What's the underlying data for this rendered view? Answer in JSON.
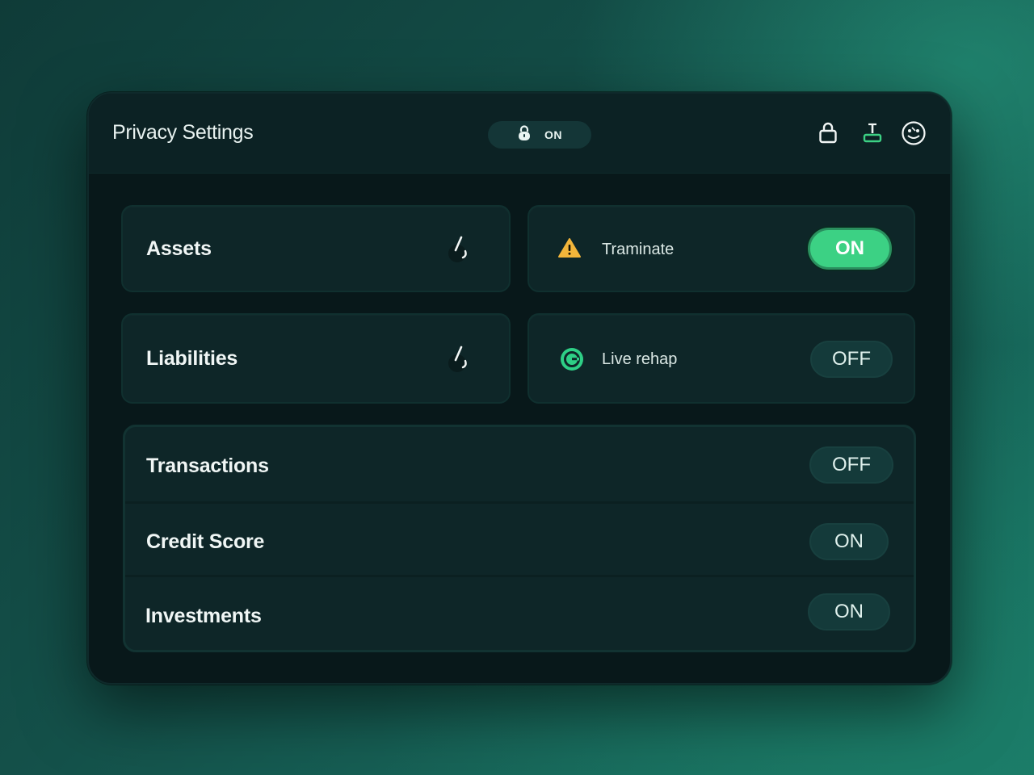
{
  "header": {
    "title": "Privacy Settings",
    "status": {
      "icon": "lock-icon",
      "label": "ON"
    },
    "actions": [
      {
        "name": "lock-icon"
      },
      {
        "name": "stamp-icon",
        "color": "#3cd184"
      },
      {
        "name": "face-icon"
      }
    ]
  },
  "cards": {
    "assets": {
      "label": "Assets",
      "action_icon": "edit-icon"
    },
    "liabilities": {
      "label": "Liabilities",
      "action_icon": "edit-icon"
    },
    "traminate": {
      "label": "Traminate",
      "icon": "warning-icon",
      "icon_color": "#f2b53a",
      "toggle": "ON",
      "toggle_active": true
    },
    "live_rehap": {
      "label": "Live rehap",
      "icon": "g-circle-icon",
      "icon_color": "#2ecf86",
      "toggle": "OFF",
      "toggle_active": false
    }
  },
  "list": [
    {
      "label": "Transactions",
      "toggle": "OFF"
    },
    {
      "label": "Credit Score",
      "toggle": "ON"
    },
    {
      "label": "Investments",
      "toggle": "ON"
    }
  ],
  "colors": {
    "accent": "#3cd184",
    "panel": "#08181a",
    "card": "#0e2628",
    "warning": "#f2b53a"
  }
}
